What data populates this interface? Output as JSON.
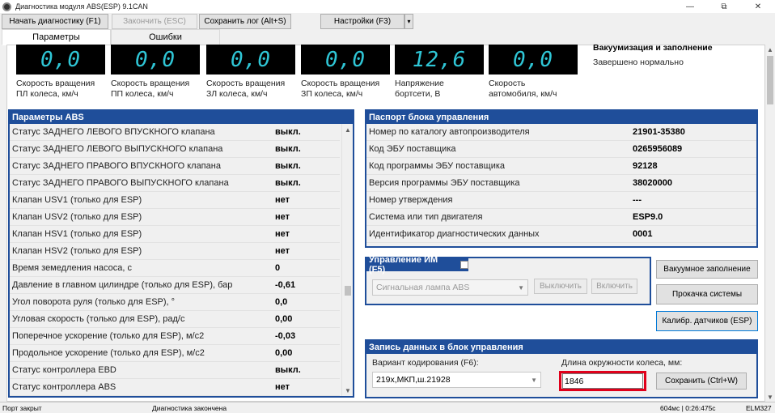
{
  "window": {
    "title": "Диагностика модуля ABS(ESP) 9.1CAN"
  },
  "toolbar": {
    "start": "Начать диагностику (F1)",
    "stop": "Закончить (ESC)",
    "save_log": "Сохранить лог (Alt+S)",
    "settings": "Настройки (F3)",
    "settings_dropdown": "▾"
  },
  "tabs": {
    "params": "Параметры",
    "errors": "Ошибки"
  },
  "gauges": [
    {
      "value": "0,0",
      "label1": "Скорость вращения",
      "label2": "ПЛ колеса, км/ч"
    },
    {
      "value": "0,0",
      "label1": "Скорость вращения",
      "label2": "ПП колеса, км/ч"
    },
    {
      "value": "0,0",
      "label1": "Скорость вращения",
      "label2": "ЗЛ колеса, км/ч"
    },
    {
      "value": "0,0",
      "label1": "Скорость вращения",
      "label2": "ЗП колеса, км/ч"
    },
    {
      "value": "12,6",
      "label1": "Напряжение",
      "label2": "бортсети, В"
    },
    {
      "value": "0,0",
      "label1": "Скорость",
      "label2": "автомобиля, км/ч"
    }
  ],
  "vacuum": {
    "title": "Вакуумизация и заполнение",
    "status": "Завершено нормально"
  },
  "abs_params": {
    "title": "Параметры ABS",
    "rows": [
      {
        "name": "Статус ЗАДНЕГО ЛЕВОГО ВПУСКНОГО клапана",
        "value": "выкл."
      },
      {
        "name": "Статус ЗАДНЕГО ЛЕВОГО ВЫПУСКНОГО клапана",
        "value": "выкл."
      },
      {
        "name": "Статус ЗАДНЕГО ПРАВОГО ВПУСКНОГО клапана",
        "value": "выкл."
      },
      {
        "name": "Статус ЗАДНЕГО ПРАВОГО ВЫПУСКНОГО клапана",
        "value": "выкл."
      },
      {
        "name": "Клапан USV1 (только для ESP)",
        "value": "нет"
      },
      {
        "name": "Клапан USV2 (только для ESP)",
        "value": "нет"
      },
      {
        "name": "Клапан HSV1 (только для ESP)",
        "value": "нет"
      },
      {
        "name": "Клапан HSV2 (только для ESP)",
        "value": "нет"
      },
      {
        "name": "Время земедления насоса, с",
        "value": "0"
      },
      {
        "name": "Давление в главном цилиндре (только для ESP), бар",
        "value": "-0,61"
      },
      {
        "name": "Угол поворота руля  (только для ESP), °",
        "value": "0,0"
      },
      {
        "name": "Угловая скорость (только для ESP), рад/с",
        "value": "0,00"
      },
      {
        "name": "Поперечное ускорение (только для ESP), м/с2",
        "value": "-0,03"
      },
      {
        "name": "Продольное ускорение (только для ESP), м/с2",
        "value": "0,00"
      },
      {
        "name": "Статус контроллера EBD",
        "value": "выкл."
      },
      {
        "name": "Статус контроллера ABS",
        "value": "нет"
      }
    ]
  },
  "passport": {
    "title": "Паспорт блока управления",
    "rows": [
      {
        "name": "Номер по каталогу автопроизводителя",
        "value": "21901-35380"
      },
      {
        "name": "Код ЭБУ поставщика",
        "value": "0265956089"
      },
      {
        "name": "Код программы ЭБУ поставщика",
        "value": "92128"
      },
      {
        "name": "Версия программы ЭБУ поставщика",
        "value": "38020000"
      },
      {
        "name": "Номер утверждения",
        "value": "---"
      },
      {
        "name": "Система или тип двигателя",
        "value": "ESP9.0"
      },
      {
        "name": "Идентификатор диагностических данных",
        "value": "0001"
      }
    ]
  },
  "im_control": {
    "title": "Управление ИМ (F5)",
    "select_value": "Сигнальная лампа ABS",
    "off_label": "Выключить",
    "on_label": "Включить"
  },
  "side_buttons": {
    "vacuum_fill": "Вакуумное заполнение",
    "bleed": "Прокачка системы",
    "calibrate": "Калибр. датчиков (ESP)"
  },
  "write_data": {
    "title": "Запись данных в блок управления",
    "coding_label": "Вариант кодирования (F6):",
    "coding_value": "219x,МКП,ш.21928",
    "wheel_label": "Длина окружности колеса, мм:",
    "wheel_value": "1846",
    "save_label": "Сохранить  (Ctrl+W)"
  },
  "status_bar": {
    "port": "Порт закрыт",
    "diag": "Диагностика закончена",
    "time": "604мс | 0:26:475с",
    "adapter": "ELM327"
  },
  "colors": {
    "accent": "#1f4e9a",
    "lcd_text": "#2fc6d6",
    "highlight": "#e0001b"
  }
}
